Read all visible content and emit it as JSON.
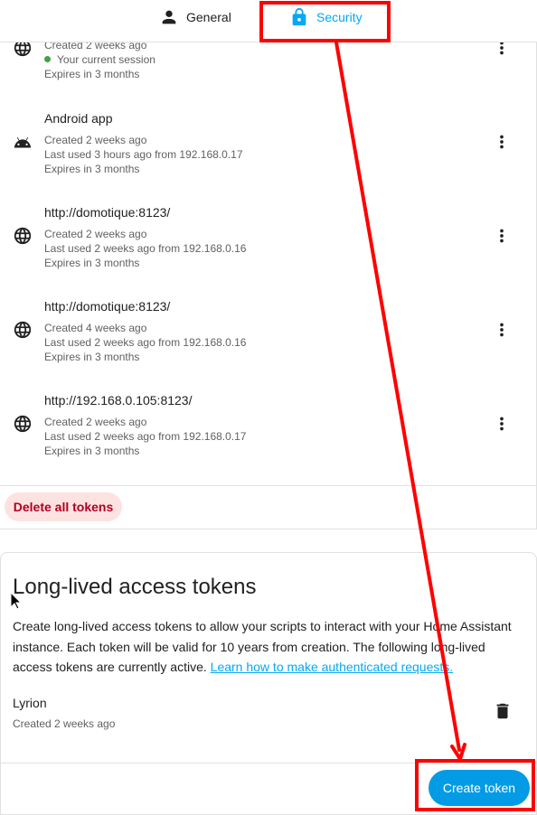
{
  "tabs": [
    {
      "label": "General",
      "icon": "account-icon"
    },
    {
      "label": "Security",
      "icon": "lock-icon",
      "active": true
    }
  ],
  "sessions": [
    {
      "icon": "globe-icon",
      "title": "",
      "lines": [
        "Created 2 weeks ago",
        "Your current session",
        "Expires in 3 months"
      ],
      "current": true
    },
    {
      "icon": "android-icon",
      "title": "Android app",
      "lines": [
        "Created 2 weeks ago",
        "Last used 3 hours ago from 192.168.0.17",
        "Expires in 3 months"
      ]
    },
    {
      "icon": "globe-icon",
      "title": "http://domotique:8123/",
      "lines": [
        "Created 2 weeks ago",
        "Last used 2 weeks ago from 192.168.0.16",
        "Expires in 3 months"
      ]
    },
    {
      "icon": "globe-icon",
      "title": "http://domotique:8123/",
      "lines": [
        "Created 4 weeks ago",
        "Last used 2 weeks ago from 192.168.0.16",
        "Expires in 3 months"
      ]
    },
    {
      "icon": "globe-icon",
      "title": "http://192.168.0.105:8123/",
      "lines": [
        "Created 2 weeks ago",
        "Last used 2 weeks ago from 192.168.0.17",
        "Expires in 3 months"
      ]
    }
  ],
  "delete_all_label": "Delete all tokens",
  "long_lived": {
    "title": "Long-lived access tokens",
    "description": "Create long-lived access tokens to allow your scripts to interact with your Home Assistant instance. Each token will be valid for 10 years from creation. The following long-lived access tokens are currently active.",
    "link_text": "Learn how to make authenticated requests.",
    "tokens": [
      {
        "name": "Lyrion",
        "created": "Created 2 weeks ago"
      }
    ],
    "create_label": "Create token"
  },
  "colors": {
    "accent": "#03a9f4",
    "button": "#039be5",
    "danger_text": "#b00020",
    "danger_bg": "#fde2e2",
    "annotation": "#ff0000",
    "session_dot": "#43a047"
  }
}
